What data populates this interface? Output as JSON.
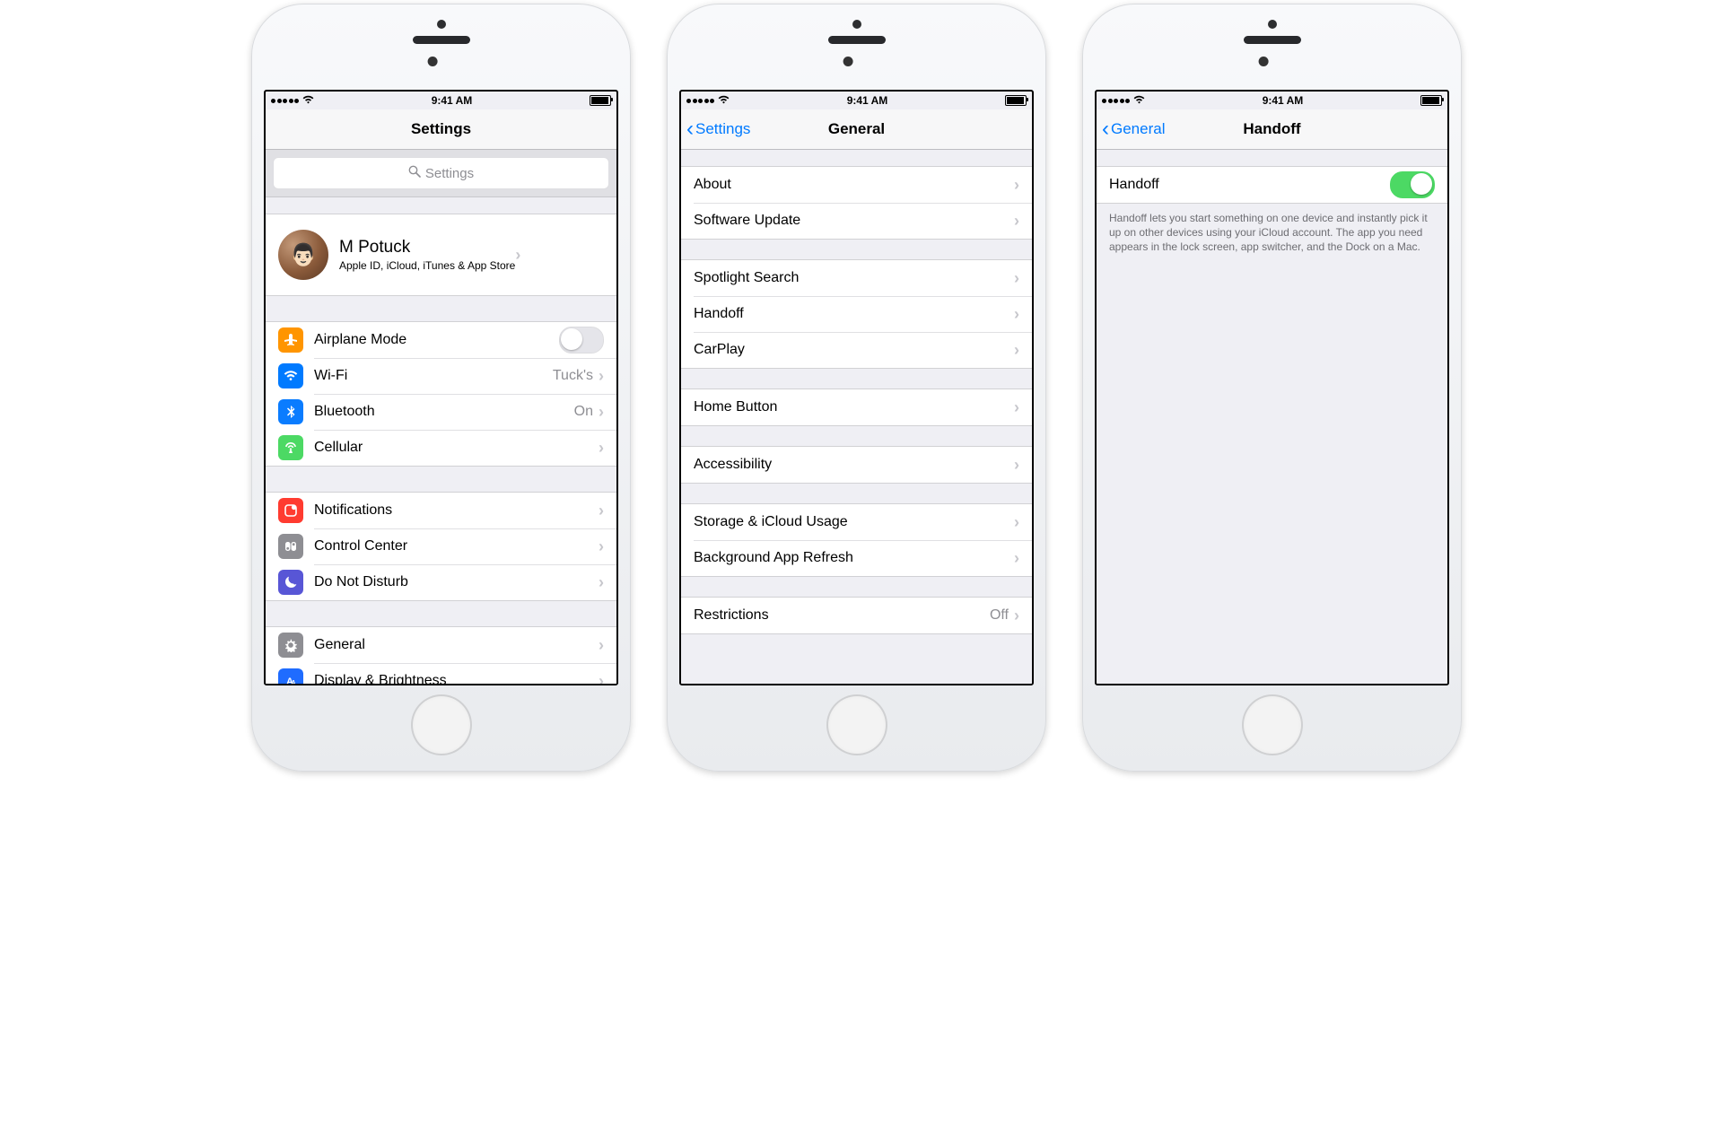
{
  "status": {
    "time": "9:41 AM"
  },
  "phone1": {
    "nav": {
      "title": "Settings"
    },
    "search": {
      "placeholder": "Settings"
    },
    "profile": {
      "name": "M Potuck",
      "subtitle": "Apple ID, iCloud, iTunes & App Store"
    },
    "group2": {
      "airplane": {
        "label": "Airplane Mode",
        "on": false
      },
      "wifi": {
        "label": "Wi-Fi",
        "value": "Tuck's"
      },
      "bluetooth": {
        "label": "Bluetooth",
        "value": "On"
      },
      "cellular": {
        "label": "Cellular"
      }
    },
    "group3": {
      "notifications": {
        "label": "Notifications"
      },
      "controlcenter": {
        "label": "Control Center"
      },
      "dnd": {
        "label": "Do Not Disturb"
      }
    },
    "group4": {
      "general": {
        "label": "General"
      },
      "display": {
        "label": "Display & Brightness"
      }
    }
  },
  "phone2": {
    "nav": {
      "back": "Settings",
      "title": "General"
    },
    "g1": {
      "about": "About",
      "software": "Software Update"
    },
    "g2": {
      "spotlight": "Spotlight Search",
      "handoff": "Handoff",
      "carplay": "CarPlay"
    },
    "g3": {
      "home": "Home Button"
    },
    "g4": {
      "accessibility": "Accessibility"
    },
    "g5": {
      "storage": "Storage & iCloud Usage",
      "refresh": "Background App Refresh"
    },
    "g6": {
      "restrictions": {
        "label": "Restrictions",
        "value": "Off"
      }
    }
  },
  "phone3": {
    "nav": {
      "back": "General",
      "title": "Handoff"
    },
    "row": {
      "label": "Handoff",
      "on": true
    },
    "footer": "Handoff lets you start something on one device and instantly pick it up on other devices using your iCloud account. The app you need appears in the lock screen, app switcher, and the Dock on a Mac."
  }
}
